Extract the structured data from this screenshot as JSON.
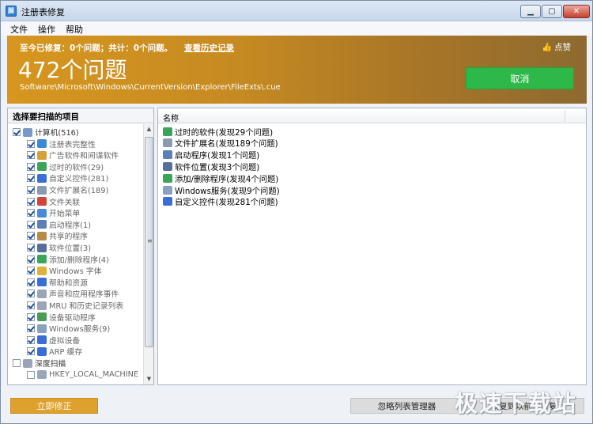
{
  "window": {
    "app_icon_text": "腿",
    "title": "注册表修复",
    "minimize_glyph": "▁",
    "maximize_glyph": "▢",
    "close_glyph": "✕"
  },
  "menu": [
    "文件",
    "操作",
    "帮助"
  ],
  "banner": {
    "stats": "至今已修复：0个问题；共计：0个问题。",
    "history_link": "查看历史记录",
    "like_label": "点赞",
    "like_icon": "👍",
    "problem_count": "472个问题",
    "scan_path": "Software\\Microsoft\\Windows\\CurrentVersion\\Explorer\\FileExts\\.cue",
    "cancel_label": "取消"
  },
  "scan_panel": {
    "title": "选择要扫描的项目",
    "items": [
      {
        "label": "计算机(516)",
        "checked": true,
        "level": 0,
        "icon": "computer-icon",
        "color": "#7c98c7"
      },
      {
        "label": "注册表完整性",
        "checked": true,
        "level": 1,
        "icon": "registry-icon",
        "color": "#3a8ad6"
      },
      {
        "label": "广告软件和间谍软件",
        "checked": true,
        "level": 1,
        "icon": "spyware-icon",
        "color": "#d6a13a"
      },
      {
        "label": "过时的软件(29)",
        "checked": true,
        "level": 1,
        "icon": "outdated-software-icon",
        "color": "#3aa55a"
      },
      {
        "label": "自定义控件(281)",
        "checked": true,
        "level": 1,
        "icon": "custom-control-icon",
        "color": "#3a6ed6"
      },
      {
        "label": "文件扩展名(189)",
        "checked": true,
        "level": 1,
        "icon": "file-extension-icon",
        "color": "#8a9ab0"
      },
      {
        "label": "文件关联",
        "checked": true,
        "level": 1,
        "icon": "file-association-icon",
        "color": "#d0453a"
      },
      {
        "label": "开始菜单",
        "checked": true,
        "level": 1,
        "icon": "start-menu-icon",
        "color": "#4a8bd8"
      },
      {
        "label": "启动程序(1)",
        "checked": true,
        "level": 1,
        "icon": "startup-icon",
        "color": "#5c7fb8"
      },
      {
        "label": "共享的程序",
        "checked": true,
        "level": 1,
        "icon": "shared-program-icon",
        "color": "#b88a4a"
      },
      {
        "label": "软件位置(3)",
        "checked": true,
        "level": 1,
        "icon": "software-location-icon",
        "color": "#5a6e9c"
      },
      {
        "label": "添加/删除程序(4)",
        "checked": true,
        "level": 1,
        "icon": "add-remove-icon",
        "color": "#3aa55a"
      },
      {
        "label": "Windows 字体",
        "checked": true,
        "level": 1,
        "icon": "font-icon",
        "color": "#e0b23a"
      },
      {
        "label": "帮助和资源",
        "checked": true,
        "level": 1,
        "icon": "help-icon",
        "color": "#3a6ed6"
      },
      {
        "label": "声音和应用程序事件",
        "checked": true,
        "level": 1,
        "icon": "sound-icon",
        "color": "#9aa6b8"
      },
      {
        "label": "MRU 和历史记录列表",
        "checked": true,
        "level": 1,
        "icon": "history-list-icon",
        "color": "#9aa6b8"
      },
      {
        "label": "设备驱动程序",
        "checked": true,
        "level": 1,
        "icon": "driver-icon",
        "color": "#4a9a5a"
      },
      {
        "label": "Windows服务(9)",
        "checked": true,
        "level": 1,
        "icon": "service-icon",
        "color": "#8aa0c0"
      },
      {
        "label": "虚拟设备",
        "checked": true,
        "level": 1,
        "icon": "virtual-device-icon",
        "color": "#3a6ed6"
      },
      {
        "label": "ARP 缓存",
        "checked": true,
        "level": 1,
        "icon": "arp-cache-icon",
        "color": "#3a6ed6"
      },
      {
        "label": "深度扫描",
        "checked": false,
        "level": 0,
        "icon": "deep-scan-icon",
        "color": "#9aa6b8"
      },
      {
        "label": "HKEY_LOCAL_MACHINE",
        "checked": false,
        "level": 1,
        "icon": "registry-hive-icon",
        "color": "#9aa6b8"
      }
    ],
    "scroll_up": "▲",
    "scroll_down": "▼",
    "scroll_grip": "≡"
  },
  "results": {
    "column_name": "名称",
    "rows": [
      {
        "label": "过时的软件(发现29个问题)",
        "icon": "outdated-software-icon",
        "color": "#3aa55a"
      },
      {
        "label": "文件扩展名(发现189个问题)",
        "icon": "file-extension-icon",
        "color": "#8a9ab0"
      },
      {
        "label": "启动程序(发现1个问题)",
        "icon": "startup-icon",
        "color": "#5c7fb8"
      },
      {
        "label": "软件位置(发现3个问题)",
        "icon": "software-location-icon",
        "color": "#5a6e9c"
      },
      {
        "label": "添加/删除程序(发现4个问题)",
        "icon": "add-remove-icon",
        "color": "#3aa55a"
      },
      {
        "label": "Windows服务(发现9个问题)",
        "icon": "service-icon",
        "color": "#8aa0c0"
      },
      {
        "label": "自定义控件(发现281个问题)",
        "icon": "custom-control-icon",
        "color": "#3a6ed6"
      }
    ]
  },
  "footer": {
    "fix_label": "立即修正",
    "ignore_label": "忽略列表管理器",
    "restore_label": "恢复到以前的修复"
  },
  "watermark": "极速下载站"
}
